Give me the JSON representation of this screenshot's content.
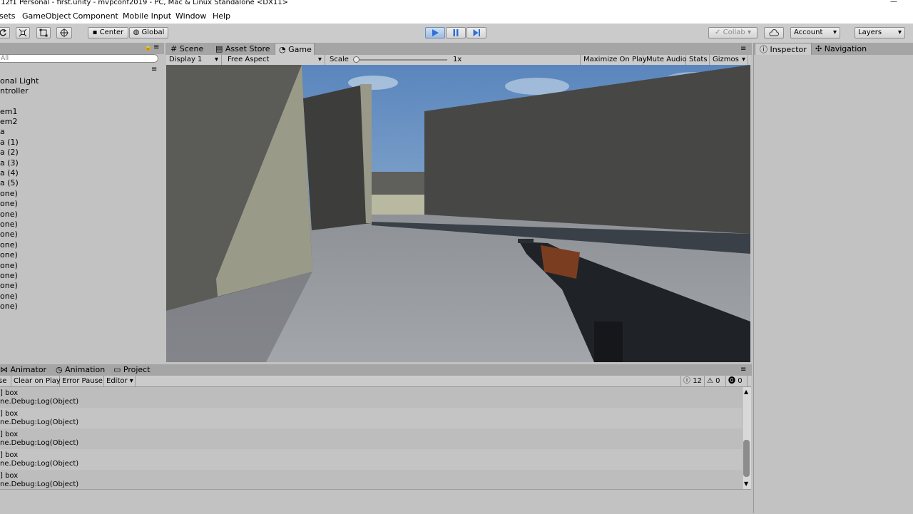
{
  "window": {
    "title": ".12f1 Personal - first.unity - mvpconf2019 - PC, Mac & Linux Standalone <DX11>",
    "minimize_glyph": "—"
  },
  "menubar": {
    "items": [
      "sets",
      "GameObject",
      "Component",
      "Mobile Input",
      "Window",
      "Help"
    ]
  },
  "toolbar": {
    "pivot_label": "Center",
    "space_label": "Global",
    "collab_label": "Collab",
    "account_label": "Account",
    "layers_label": "Layers"
  },
  "hierarchy": {
    "search_placeholder": "All",
    "items": [
      "onal Light",
      "ntroller",
      "",
      "em1",
      "em2",
      "a",
      "a (1)",
      "a (2)",
      "a (3)",
      "a (4)",
      "a (5)",
      "one)",
      "one)",
      "one)",
      "one)",
      "one)",
      "one)",
      "one)",
      "one)",
      "one)",
      "one)",
      "one)",
      "one)"
    ]
  },
  "center_tabs": {
    "scene": "Scene",
    "asset_store": "Asset Store",
    "game": "Game"
  },
  "game_toolbar": {
    "display": "Display 1",
    "aspect": "Free Aspect",
    "scale_label": "Scale",
    "scale_value": "1x",
    "scale_level": 0,
    "maximize": "Maximize On Play",
    "mute": "Mute Audio",
    "stats": "Stats",
    "gizmos": "Gizmos"
  },
  "right_tabs": {
    "inspector": "Inspector",
    "navigation": "Navigation"
  },
  "bottom_tabs": {
    "animator": "Animator",
    "animation": "Animation",
    "project": "Project"
  },
  "console_toolbar": {
    "clear": "se",
    "clear_on_play": "Clear on Play",
    "error_pause": "Error Pause",
    "editor": "Editor",
    "log_count": "12",
    "warn_count": "0",
    "error_count": "0"
  },
  "console_logs": [
    {
      "line1": "] box",
      "line2": "ne.Debug:Log(Object)"
    },
    {
      "line1": "] box",
      "line2": "ne.Debug:Log(Object)"
    },
    {
      "line1": "] box",
      "line2": "ne.Debug:Log(Object)"
    },
    {
      "line1": "] box",
      "line2": "ne.Debug:Log(Object)"
    },
    {
      "line1": "] box",
      "line2": "ne.Debug:Log(Object)"
    }
  ],
  "colors": {
    "accent_play": "#3b7bd8",
    "panel": "#c2c2c2",
    "tabstrip": "#a5a5a5"
  }
}
